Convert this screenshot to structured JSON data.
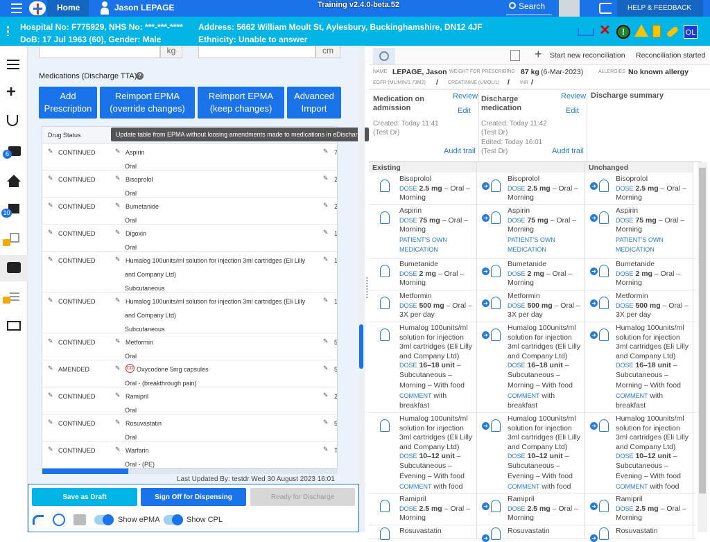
{
  "topbar": {
    "home": "Home",
    "user": "Jason LEPAGE",
    "version": "Training v2.4.0-beta.52",
    "search": "Search",
    "help": "HELP & FEEDBACK"
  },
  "patient": {
    "hospital_no": "Hospital No: F775929, NHS No: ***-***-****",
    "dob": "DoB: 17 Jul 1963 (60), Gender: Male",
    "address": "Address: 5662 William Moult St, Aylesbury, Buckinghamshire, DN12 4JF",
    "ethnicity": "Ethnicity: Unable to answer",
    "initials": "OL"
  },
  "sidenav": {
    "badge_camera": "6",
    "badge_edit": "10"
  },
  "left": {
    "unit_kg": "kg",
    "unit_cm": "cm",
    "section_title": "Medications (Discharge TTA)",
    "buttons": [
      "Add Prescription",
      "Reimport EPMA (override changes)",
      "Reimport EPMA (keep changes)",
      "Advanced Import"
    ],
    "col_status": "Drug Status",
    "tooltip": "Update table from EPMA without loosing amendments made to medications in eDischarge",
    "last_updated": "Last Updated By: testdr Wed 30 August 2023 16:01",
    "cd_badge": "CD"
  },
  "rows": [
    {
      "status": "CONTINUED",
      "drug": "Aspirin",
      "route": "Oral",
      "right": "7"
    },
    {
      "status": "CONTINUED",
      "drug": "Bisoprolol",
      "route": "Oral",
      "right": "2"
    },
    {
      "status": "CONTINUED",
      "drug": "Bumetanide",
      "route": "Oral",
      "right": "2"
    },
    {
      "status": "CONTINUED",
      "drug": "Digoxin",
      "route": "Oral",
      "right": "1"
    },
    {
      "status": "CONTINUED",
      "drug": "Humalog 100units/ml solution for injection 3ml cartridges (Eli Lilly",
      "drug2": "and Company Ltd)",
      "route": "Subcutaneous",
      "right": "1"
    },
    {
      "status": "CONTINUED",
      "drug": "Humalog 100units/ml solution for injection 3ml cartridges (Eli Lilly",
      "drug2": "and Company Ltd)",
      "route": "Subcutaneous",
      "right": "1"
    },
    {
      "status": "CONTINUED",
      "drug": "Metformin",
      "route": "Oral",
      "right": "5"
    },
    {
      "status": "AMENDED",
      "drug": "Oxycodone 5mg capsules",
      "route": "Oral - (breakthrough pain)",
      "right": "5"
    },
    {
      "status": "CONTINUED",
      "drug": "Ramipril",
      "route": "Oral",
      "right": "2"
    },
    {
      "status": "CONTINUED",
      "drug": "Rosuvastatin",
      "route": "Oral",
      "right": "5"
    },
    {
      "status": "CONTINUED",
      "drug": "Warfarin",
      "route": "Oral - (PE)",
      "right": "T"
    }
  ],
  "footer": {
    "save_draft": "Save as Draft",
    "sign_off": "Sign Off for Dispensing",
    "ready": "Ready for Discharge",
    "show_epma": "Show ePMA",
    "show_cpl": "Show CPL"
  },
  "recon": {
    "new": "Start new reconciliation",
    "started": "Reconciliation started",
    "name_label": "NAME",
    "name": "LEPAGE, Jason",
    "weight_label": "WEIGHT FOR PRESCRIBING",
    "weight": "87 kg",
    "weight_date": "(6-Mar-2023)",
    "allergies_label": "ALLERGIES",
    "allergies": "No known allergy",
    "egfr_label": "EGFR (ML/MIN/1.73M2)",
    "egfr": "/",
    "creat_label": "CREATININE (UMOL/L)",
    "creat": "/",
    "inr_label": "INR",
    "inr": "/"
  },
  "cols": [
    {
      "title1": "Medication on",
      "title2": "admission",
      "review": "Review",
      "edit": "Edit",
      "created": "Created: Today 11:41",
      "by": "(Test Dr)",
      "audit": "Audit trail",
      "section": "Existing"
    },
    {
      "title1": "Discharge",
      "title2": "medication",
      "review": "Review",
      "edit": "Edit",
      "created": "Created: Today 11:42",
      "by": "(Test Dr)",
      "edited": "Edited: Today 16:01",
      "by2": "(Test Dr)",
      "audit": "Audit trail",
      "section": ""
    },
    {
      "title1": "Discharge summary",
      "section": "Unchanged"
    }
  ],
  "meds": [
    {
      "name": "Bisoprolol",
      "dose_l": "DOSE",
      "dose": "2.5 mg",
      "rest": "– Oral –",
      "line3": "Morning"
    },
    {
      "name": "Aspirin",
      "dose_l": "DOSE",
      "dose": "75 mg",
      "rest": "– Oral –",
      "line3": "Morning",
      "extra1": "PATIENT'S OWN",
      "extra2": "MEDICATION"
    },
    {
      "name": "Bumetanide",
      "dose_l": "DOSE",
      "dose": "2 mg",
      "rest": "– Oral –",
      "line3": "Morning"
    },
    {
      "name": "Metformin",
      "dose_l": "DOSE",
      "dose": "500 mg",
      "rest": "– Oral –",
      "line3": "3X per day"
    },
    {
      "name": "Humalog 100units/ml",
      "n2": "solution for injection",
      "n3": "3ml cartridges (Eli Lilly",
      "n4": "and Company Ltd)",
      "dose_l": "DOSE",
      "dose": "16–18 unit",
      "rest": "–",
      "l2": "Subcutaneous –",
      "l3": "Morning – With food",
      "c_l": "COMMENT",
      "c": "with",
      "c2": "breakfast"
    },
    {
      "name": "Humalog 100units/ml",
      "n2": "solution for injection",
      "n3": "3ml cartridges (Eli Lilly",
      "n4": "and Company Ltd)",
      "dose_l": "DOSE",
      "dose": "10–12 unit",
      "rest": "–",
      "l2": "Subcutaneous –",
      "l3": "Evening – With food",
      "c_l": "COMMENT",
      "c": "with food"
    },
    {
      "name": "Ramipril",
      "dose_l": "DOSE",
      "dose": "2.5 mg",
      "rest": "– Oral –",
      "line3": "Morning"
    },
    {
      "name": "Rosuvastatin"
    }
  ]
}
